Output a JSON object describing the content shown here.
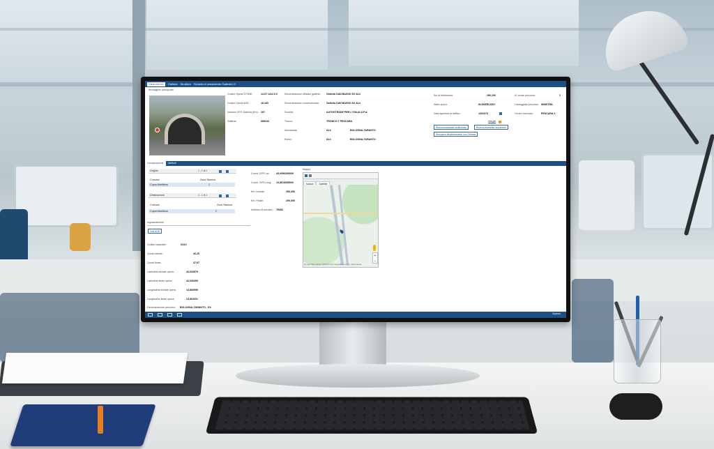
{
  "topbar": {
    "home": "Vista elenco",
    "crumbs": [
      "Galleria",
      "Strutture",
      "Scheda di censimento Galleria L0"
    ]
  },
  "header": {
    "section_title": "Immagine principale"
  },
  "col1": [
    {
      "label": "Codice Opera STONE:",
      "value": "14.07.1412.0.0"
    },
    {
      "label": "Codice Opera AGE:",
      "value": "18.160"
    },
    {
      "label": "Numero CPG Galleria (Km):",
      "value": "107"
    },
    {
      "label": "Galleria:",
      "value": "685243"
    }
  ],
  "col2": [
    {
      "label": "Denominazione ufficiale galleria:",
      "value": "Galleria SAN BASSO SX A14"
    },
    {
      "label": "Denominazione convenzionale:",
      "value": "Galleria SAN BASSO SX A14"
    },
    {
      "label": "Società:",
      "value": "AUTOSTRADE PER L'ITALIA S.P.A."
    },
    {
      "label": "Tronco:",
      "value": "TRONCO 7 PESCARA"
    },
    {
      "label": "Autostrada:",
      "value": "A14",
      "extra": "BOLOGNA-TARANTO"
    },
    {
      "label": "Ramo:",
      "value": "A14",
      "extra": "BOLOGNA-TARANTO"
    }
  ],
  "col3": [
    {
      "label": "Km di riferimento:",
      "value": "296,190"
    },
    {
      "label": "Stato opera:",
      "value": "IN ESERCIZIO"
    },
    {
      "label": "Data apertura al traffico:",
      "value": "14/04/73"
    }
  ],
  "col4": [
    {
      "label": "N. corsie percorso:",
      "value": "2"
    },
    {
      "label": "Carreggiata percorso:",
      "value": "SINISTRA"
    },
    {
      "label": "Centro esercizio:",
      "value": "PESCARA 2"
    }
  ],
  "actions": {
    "link": "Allegati",
    "btn_multimedia": "Ricerca avanzata multimedia",
    "btn_documenti": "Ricerca avanzata documenti",
    "btn_recupero": "Recupera disallineamenti con Oribase"
  },
  "tabs": [
    "Localizzazione",
    "Attributi"
  ],
  "origine": {
    "title": "Origine",
    "pager": "1 - 1 di 1",
    "col_a": "Comune",
    "col_b": "Zona Sismica",
    "row_a": "Cupra Marittima",
    "row_b": "2"
  },
  "destinazione": {
    "title": "Destinazione",
    "pager": "1 - 1 di 1",
    "col_a": "Comune",
    "col_b": "Zona Sismica",
    "row_a": "Cupra Marittima",
    "row_b": "2"
  },
  "inquadramento": {
    "title": "Inquadramento",
    "button": "Link AGE"
  },
  "coords": [
    {
      "label": "Coord. GPS Lat.:",
      "value": "43,0096200000"
    },
    {
      "label": "Coord. GPS Long.:",
      "value": "13,8918335000"
    },
    {
      "label": "Km. Iniziale:",
      "value": "296,350"
    },
    {
      "label": "Km. Finale:",
      "value": "296,300"
    },
    {
      "label": "Indirizzo di servizio:",
      "value": "75452"
    }
  ],
  "lower": [
    {
      "label": "Codice catastale:",
      "value": "D210"
    },
    {
      "label": "Quota iniziale:",
      "value": "26,25"
    },
    {
      "label": "Quota finale:",
      "value": "37,87"
    },
    {
      "label": "Latitudine iniziale opera:",
      "value": "43,033979"
    },
    {
      "label": "Latitudine finale opera:",
      "value": "43,035459"
    },
    {
      "label": "Longitudine iniziale opera:",
      "value": "13,860999"
    },
    {
      "label": "Longitudine finale opera:",
      "value": "13,862601"
    },
    {
      "label": "Denominazione percorso:",
      "value": "BOLOGNA-TARANTO - SX"
    }
  ],
  "map": {
    "title": "Mappa",
    "tab_map": "Mappa",
    "tab_sat": "Satellite",
    "footer": "Google  Dati mappa ©2023  Termini  Segnala un errore nella mappa"
  },
  "bottombar": {
    "right": "Opzioni"
  },
  "colors": {
    "accent": "#1d4f86",
    "selected_row": "#dbe8f4"
  }
}
